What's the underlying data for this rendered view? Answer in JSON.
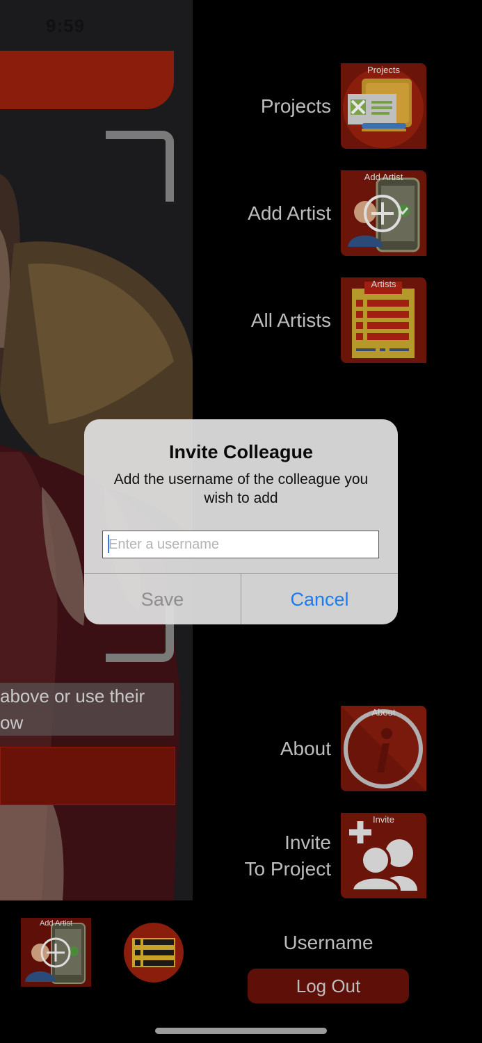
{
  "status_bar": {
    "time": "9:59"
  },
  "left_screen": {
    "instruction_text": {
      "line1": "above or use their",
      "line2": "ow"
    }
  },
  "menu": {
    "items": [
      {
        "label": "Projects",
        "tile_caption": "Projects",
        "icon": "projects-folder-icon"
      },
      {
        "label": "Add Artist",
        "tile_caption": "Add Artist",
        "icon": "add-artist-phone-icon"
      },
      {
        "label": "All Artists",
        "tile_caption": "Artists",
        "icon": "artists-list-icon"
      },
      {
        "label": "About",
        "tile_caption": "About",
        "icon": "info-icon"
      },
      {
        "label_line1": "Invite",
        "label_line2": "To Project",
        "tile_caption": "Invite",
        "icon": "invite-users-icon"
      }
    ]
  },
  "bottom": {
    "add_artist_caption": "Add Artist",
    "username": "Username",
    "logout_label": "Log Out"
  },
  "dialog": {
    "title": "Invite Colleague",
    "message": "Add the username of the colleague you wish to add",
    "input_value": "",
    "input_placeholder": "Enter a username",
    "save_label": "Save",
    "cancel_label": "Cancel"
  },
  "colors": {
    "tile_red": "#6b1409",
    "accent_blue": "#1a7cf5",
    "disabled_gray": "#8e8e8e"
  }
}
